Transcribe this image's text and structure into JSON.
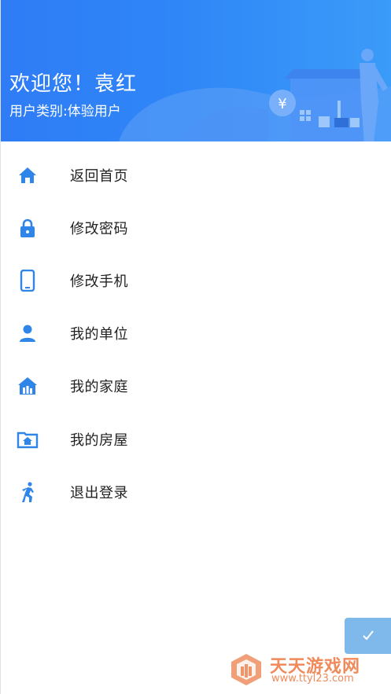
{
  "header": {
    "welcome_text": "欢迎您！",
    "user_name": "袁红",
    "user_type_label": "用户类别:",
    "user_type_value": "体验用户",
    "bg_color": "#2f86f7"
  },
  "menu": {
    "icon_color": "#2f86e8",
    "items": [
      {
        "label": "返回首页",
        "icon": "home-icon"
      },
      {
        "label": "修改密码",
        "icon": "lock-icon"
      },
      {
        "label": "修改手机",
        "icon": "phone-icon"
      },
      {
        "label": "我的单位",
        "icon": "person-icon"
      },
      {
        "label": "我的家庭",
        "icon": "family-icon"
      },
      {
        "label": "我的房屋",
        "icon": "house-folder-icon"
      },
      {
        "label": "退出登录",
        "icon": "logout-icon"
      }
    ]
  },
  "watermark": {
    "title": "天天游戏网",
    "url": "www.ttyl23.com"
  }
}
